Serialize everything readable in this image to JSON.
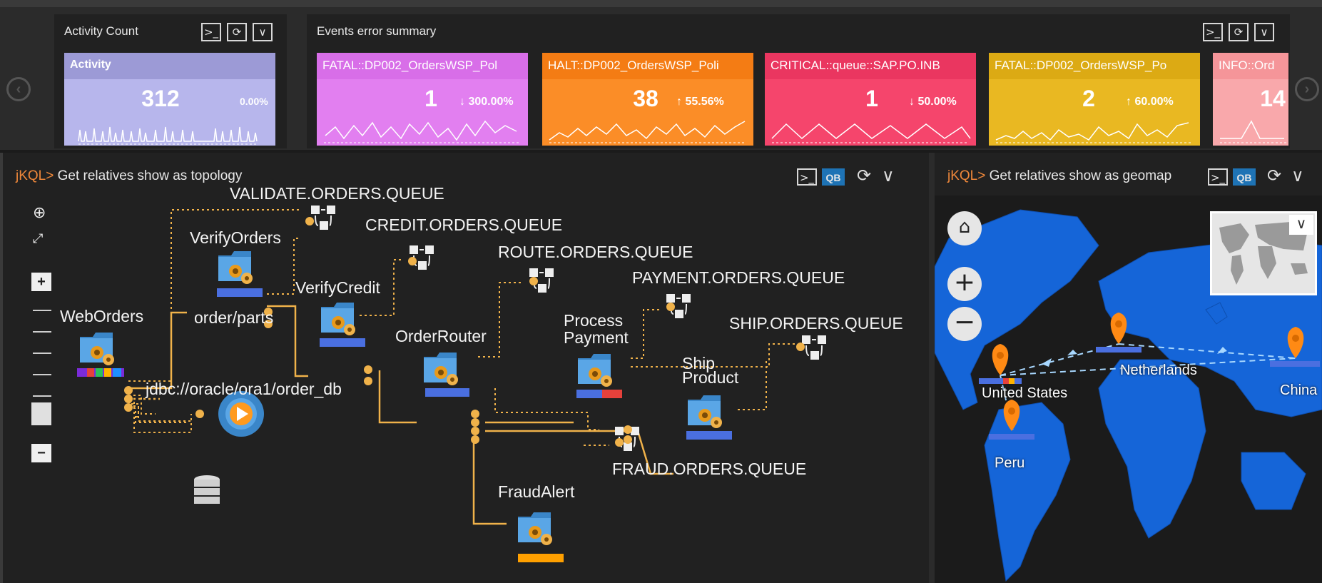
{
  "nav": {
    "left_icon": "chevron-left-circle-icon",
    "right_icon": "chevron-right-circle-icon"
  },
  "activity_panel": {
    "title": "Activity Count",
    "tile": {
      "name": "Activity",
      "value": "312",
      "change": "0.00%",
      "color": "#b7b6ec",
      "head_color": "#9c9ad6"
    }
  },
  "errors_panel": {
    "title": "Events error summary",
    "tiles": [
      {
        "name": "FATAL::DP002_OrdersWSP_Pol",
        "value": "1",
        "arrow": "↓",
        "change": "300.00%",
        "color": "#e27ff0",
        "head_color": "#d86ee8"
      },
      {
        "name": "HALT::DP002_OrdersWSP_Poli",
        "value": "38",
        "arrow": "↑",
        "change": "55.56%",
        "color": "#fb8d27",
        "head_color": "#f47c14"
      },
      {
        "name": "CRITICAL::queue::SAP.PO.INB",
        "value": "1",
        "arrow": "↓",
        "change": "50.00%",
        "color": "#f5456c",
        "head_color": "#ea3660"
      },
      {
        "name": "FATAL::DP002_OrdersWSP_Po",
        "value": "2",
        "arrow": "↑",
        "change": "60.00%",
        "color": "#e9b822",
        "head_color": "#dcaa14"
      },
      {
        "name": "INFO::Ord",
        "value": "14",
        "arrow": "",
        "change": "",
        "color": "#f9a8ab",
        "head_color": "#f59599"
      }
    ]
  },
  "toolbar": {
    "terminal": ">_",
    "refresh": "⟳",
    "collapse": "∨",
    "qb": "QB"
  },
  "topology": {
    "prefix": "jKQL>",
    "query": " Get relatives show as topology",
    "labels": {
      "validate_q": "VALIDATE.ORDERS.QUEUE",
      "credit_q": "CREDIT.ORDERS.QUEUE",
      "route_q": "ROUTE.ORDERS.QUEUE",
      "payment_q": "PAYMENT.ORDERS.QUEUE",
      "ship_q": "SHIP.ORDERS.QUEUE",
      "fraud_q": "FRAUD.ORDERS.QUEUE",
      "verify_orders": "VerifyOrders",
      "verify_credit": "VerifyCredit",
      "web_orders": "WebOrders",
      "order_parts": "order/parts",
      "order_router": "OrderRouter",
      "process": "Process",
      "payment": "Payment",
      "ship": "Ship",
      "product": "Product",
      "fraud_alert": "FraudAlert",
      "jdbc": "jdbc://oracle/ora1/order_db"
    },
    "colors": {
      "edge": "#f0b24a",
      "node_blue": "#3a86c9",
      "bar_blue": "#4a6fe0",
      "bar_orange": "#ffa000"
    }
  },
  "geomap": {
    "prefix": "jKQL>",
    "query": " Get relatives show as geomap",
    "places": {
      "us": "United States",
      "nl": "Netherlands",
      "cn": "China",
      "pe": "Peru"
    },
    "colors": {
      "sea": "#1b1b1b",
      "land": "#1565d8",
      "pin": "#ff8a14"
    }
  }
}
